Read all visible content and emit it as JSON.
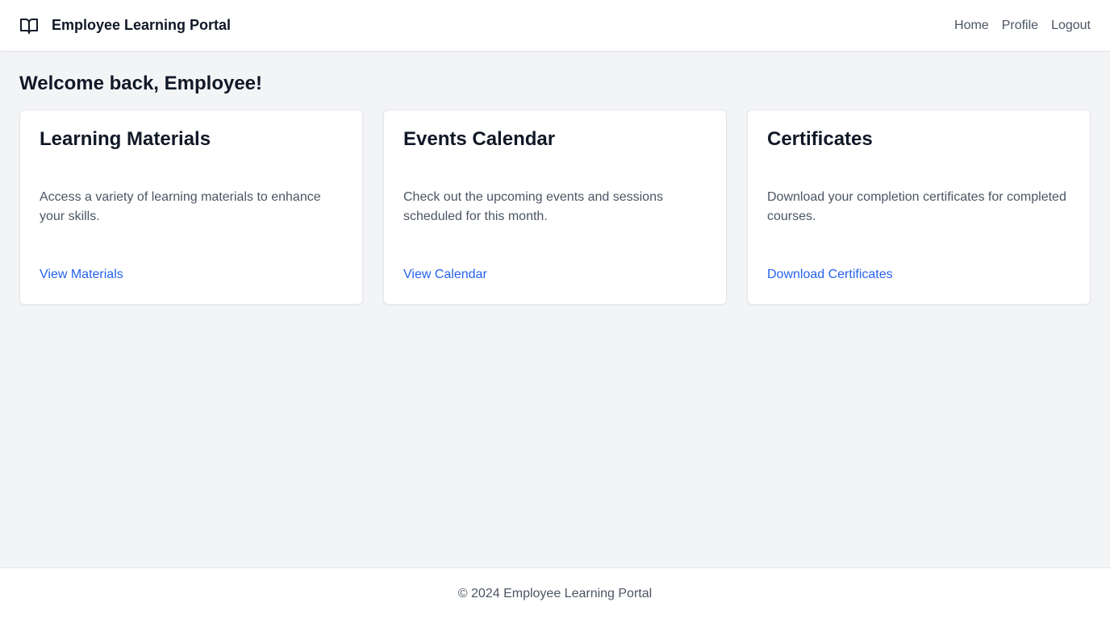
{
  "header": {
    "brand_icon": "open-book-icon",
    "title": "Employee Learning Portal",
    "nav": [
      {
        "label": "Home"
      },
      {
        "label": "Profile"
      },
      {
        "label": "Logout"
      }
    ]
  },
  "main": {
    "welcome": "Welcome back, Employee!",
    "cards": [
      {
        "title": "Learning Materials",
        "description": "Access a variety of learning materials to enhance your skills.",
        "link": "View Materials"
      },
      {
        "title": "Events Calendar",
        "description": "Check out the upcoming events and sessions scheduled for this month.",
        "link": "View Calendar"
      },
      {
        "title": "Certificates",
        "description": "Download your completion certificates for completed courses.",
        "link": "Download Certificates"
      }
    ]
  },
  "footer": {
    "text": "© 2024 Employee Learning Portal"
  },
  "colors": {
    "background": "#f3f4f6",
    "surface": "#ffffff",
    "link": "#2563eb",
    "muted_text": "#4b5563",
    "heading_text": "#111827"
  }
}
